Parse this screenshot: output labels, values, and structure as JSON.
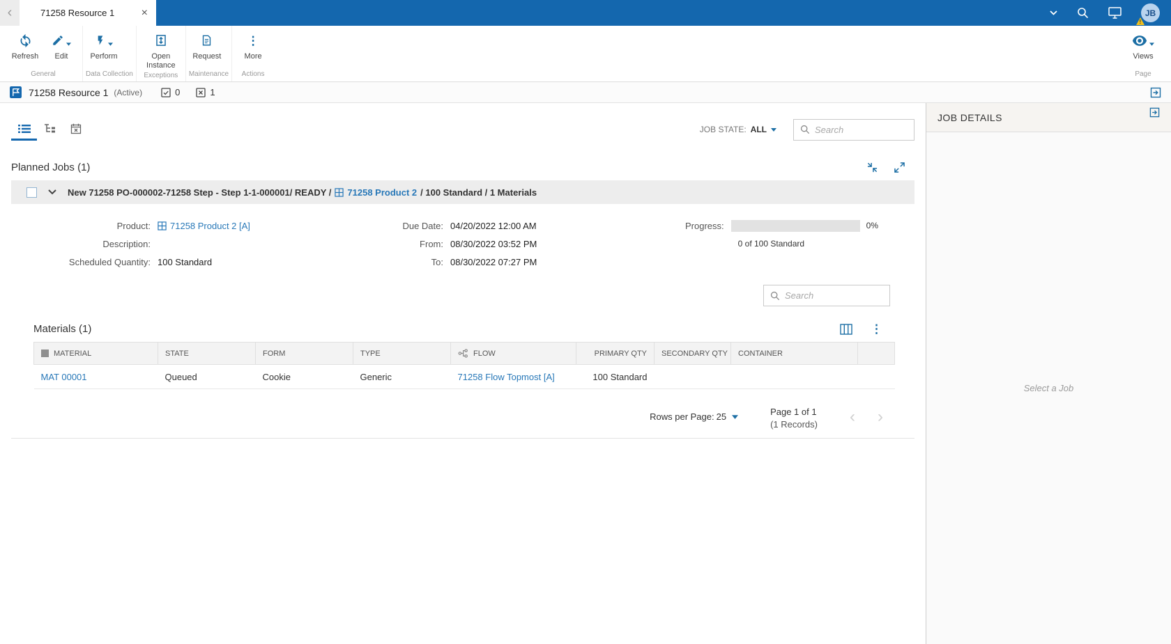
{
  "topbar": {
    "tab_title": "71258 Resource 1",
    "avatar_initials": "JB"
  },
  "icons": {
    "close": "×",
    "back_chevron": "‹",
    "more_dots": "⋮",
    "prev_chevron": "‹",
    "next_chevron": "›"
  },
  "toolbar": {
    "groups": [
      {
        "name": "General",
        "buttons": [
          {
            "label": "Refresh"
          },
          {
            "label": "Edit"
          }
        ]
      },
      {
        "name": "Data Collection",
        "buttons": [
          {
            "label": "Perform"
          }
        ]
      },
      {
        "name": "Exceptions",
        "buttons": [
          {
            "label": "Open Instance"
          }
        ]
      },
      {
        "name": "Maintenance",
        "buttons": [
          {
            "label": "Request"
          }
        ]
      },
      {
        "name": "Actions",
        "buttons": [
          {
            "label": "More"
          }
        ]
      }
    ],
    "page_group": {
      "name": "Page",
      "button_label": "Views"
    }
  },
  "resource_bar": {
    "title": "71258 Resource 1",
    "status": "(Active)",
    "check_count": "0",
    "x_count": "1"
  },
  "filters": {
    "job_state_label": "JOB STATE:",
    "job_state_value": "ALL",
    "search_placeholder": "Search"
  },
  "planned_jobs": {
    "title": "Planned Jobs (1)",
    "job": {
      "header_prefix": "New 71258 PO-000002-71258 Step - Step 1-1-000001/ READY /",
      "header_product": "71258 Product 2",
      "header_suffix": "/ 100 Standard / 1 Materials",
      "details": {
        "product_label": "Product:",
        "product_value": "71258 Product 2 [A]",
        "description_label": "Description:",
        "description_value": "",
        "scheduled_qty_label": "Scheduled Quantity:",
        "scheduled_qty_value": "100  Standard",
        "due_date_label": "Due Date:",
        "due_date_value": "04/20/2022 12:00 AM",
        "from_label": "From:",
        "from_value": "08/30/2022 03:52 PM",
        "to_label": "To:",
        "to_value": "08/30/2022 07:27 PM",
        "progress_label": "Progress:",
        "progress_value": 0,
        "progress_percent": "0%",
        "progress_caption": "0 of 100 Standard"
      }
    }
  },
  "materials": {
    "title": "Materials (1)",
    "search_placeholder": "Search",
    "table": {
      "headers": [
        "MATERIAL",
        "STATE",
        "FORM",
        "TYPE",
        "FLOW",
        "PRIMARY QTY",
        "SECONDARY QTY",
        "CONTAINER"
      ],
      "rows": [
        {
          "material": "MAT 00001",
          "state": "Queued",
          "form": "Cookie",
          "type": "Generic",
          "flow": "71258 Flow Topmost [A]",
          "primary_qty": "100 Standard",
          "secondary_qty": "",
          "container": ""
        }
      ]
    },
    "pagination": {
      "rows_per_page_label": "Rows per Page:",
      "rows_per_page_value": "25",
      "page_info": "Page 1 of 1",
      "records_info": "(1 Records)"
    }
  },
  "job_details_panel": {
    "title": "JOB DETAILS",
    "empty_message": "Select a Job"
  }
}
